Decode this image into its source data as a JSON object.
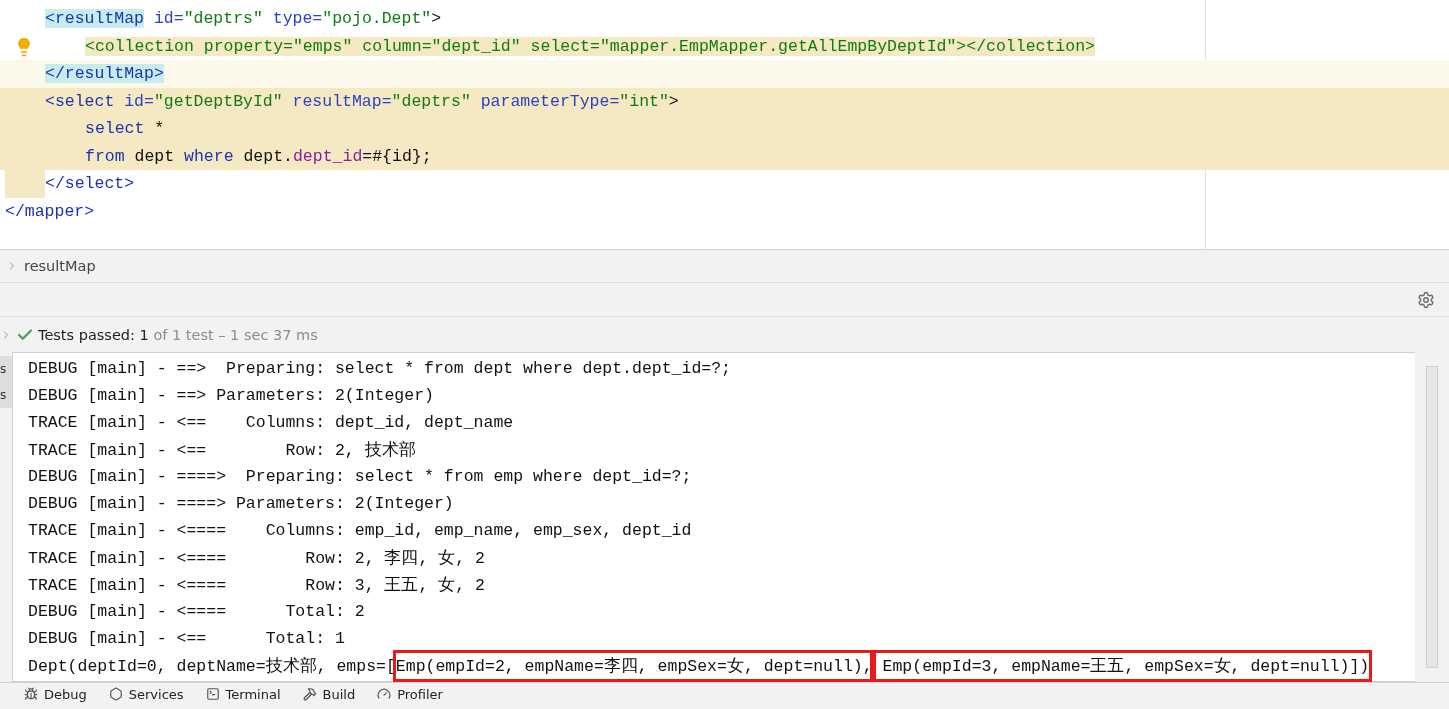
{
  "editor": {
    "lines": [
      {
        "kind": "plain",
        "bulb": false,
        "tokens": [
          {
            "kind": "tag-match",
            "text": "<resultMap"
          },
          {
            "kind": "attr",
            "text": " id="
          },
          {
            "kind": "value",
            "text": "\"deptrs\""
          },
          {
            "kind": "attr",
            "text": " type="
          },
          {
            "kind": "value",
            "text": "\"pojo.Dept\""
          },
          {
            "kind": "plain",
            "text": ">"
          }
        ],
        "children": [
          {
            "kind": "plain",
            "bulb": true,
            "tokens": [
              {
                "kind": "frag",
                "text": "<collection property=\"emps\" column=\"dept_id\" select=\"mapper.EmpMapper.getAllEmpByDeptId\"></collection>"
              }
            ]
          }
        ]
      },
      {
        "kind": "caret",
        "bulb": false,
        "tokens": [
          {
            "kind": "tag-match",
            "text": "</resultMap>"
          }
        ]
      },
      {
        "kind": "fragment",
        "bulb": false,
        "tokens": [
          {
            "kind": "tag",
            "text": "<select"
          },
          {
            "kind": "attr",
            "text": " id="
          },
          {
            "kind": "value",
            "text": "\"getDeptById\""
          },
          {
            "kind": "attr",
            "text": " resultMap="
          },
          {
            "kind": "value",
            "text": "\"deptrs\""
          },
          {
            "kind": "attr",
            "text": " parameterType="
          },
          {
            "kind": "value",
            "text": "\"int\""
          },
          {
            "kind": "plain",
            "text": ">"
          }
        ],
        "children": [
          {
            "kind": "fragment",
            "bulb": false,
            "tokens": [
              {
                "kind": "keyword",
                "text": "select"
              },
              {
                "kind": "plain",
                "text": " *"
              }
            ]
          },
          {
            "kind": "fragment",
            "bulb": false,
            "tokens": [
              {
                "kind": "keyword",
                "text": "from"
              },
              {
                "kind": "plain",
                "text": " dept "
              },
              {
                "kind": "keyword",
                "text": "where"
              },
              {
                "kind": "plain",
                "text": " dept."
              },
              {
                "kind": "field",
                "text": "dept_id"
              },
              {
                "kind": "plain",
                "text": "=#{id};"
              }
            ]
          }
        ]
      },
      {
        "kind": "gutter",
        "bulb": false,
        "tokens": [
          {
            "kind": "tag",
            "text": "</select>"
          }
        ]
      }
    ],
    "last_line": {
      "tokens": [
        {
          "kind": "tag",
          "text": "</mapper>"
        }
      ]
    }
  },
  "breadcrumb": "resultMap",
  "tests": {
    "label": "Tests passed:",
    "count": "1",
    "detail": "of 1 test – 1 sec 37 ms"
  },
  "side_labels": [
    "s",
    "s"
  ],
  "console": [
    [
      {
        "text": "DEBUG [main] - ==>  Preparing: select * from dept where dept.dept_id=?;",
        "boxed": false
      }
    ],
    [
      {
        "text": "DEBUG [main] - ==> Parameters: 2(Integer)",
        "boxed": false
      }
    ],
    [
      {
        "text": "TRACE [main] - <==    Columns: dept_id, dept_name",
        "boxed": false
      }
    ],
    [
      {
        "text": "TRACE [main] - <==        Row: 2, 技术部",
        "boxed": false
      }
    ],
    [
      {
        "text": "DEBUG [main] - ====>  Preparing: select * from emp where dept_id=?;",
        "boxed": false
      }
    ],
    [
      {
        "text": "DEBUG [main] - ====> Parameters: 2(Integer)",
        "boxed": false
      }
    ],
    [
      {
        "text": "TRACE [main] - <====    Columns: emp_id, emp_name, emp_sex, dept_id",
        "boxed": false
      }
    ],
    [
      {
        "text": "TRACE [main] - <====        Row: 2, 李四, 女, 2",
        "boxed": false
      }
    ],
    [
      {
        "text": "TRACE [main] - <====        Row: 3, 王五, 女, 2",
        "boxed": false
      }
    ],
    [
      {
        "text": "DEBUG [main] - <====      Total: 2",
        "boxed": false
      }
    ],
    [
      {
        "text": "DEBUG [main] - <==      Total: 1",
        "boxed": false
      }
    ],
    [
      {
        "text": "Dept(deptId=0, deptName=技术部, emps=[",
        "boxed": false
      },
      {
        "text": "Emp(empId=2, empName=李四, empSex=女, dept=null),",
        "boxed": true
      },
      {
        "text": " Emp(empId=3, empName=王五, empSex=女, dept=null)])",
        "boxed": true
      }
    ]
  ],
  "tool_tabs": [
    {
      "label": "Debug"
    },
    {
      "label": "Services"
    },
    {
      "label": "Terminal"
    },
    {
      "label": "Build"
    },
    {
      "label": "Profiler"
    }
  ]
}
